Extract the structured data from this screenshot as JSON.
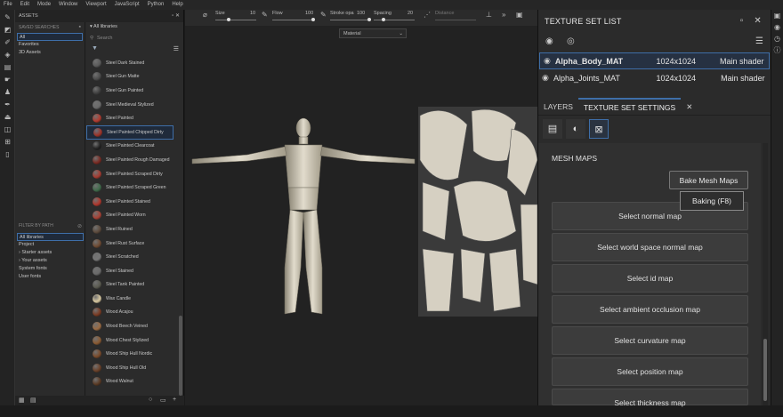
{
  "menu": [
    "File",
    "Edit",
    "Mode",
    "Window",
    "Viewport",
    "JavaScript",
    "Python",
    "Help"
  ],
  "assets": {
    "title": "ASSETS",
    "saved_searches_label": "SAVED SEARCHES",
    "saved": [
      "All",
      "Favorites",
      "3D Assets"
    ],
    "filter_by_path_label": "FILTER BY PATH",
    "paths": [
      "All libraries",
      "Project",
      "Starter assets",
      "Your assets",
      "System fonts",
      "User fonts"
    ],
    "library_header": "All libraries",
    "search_placeholder": "Search",
    "materials": [
      {
        "name": "Steel Dark Stained",
        "color": "#5a5a5a"
      },
      {
        "name": "Steel Gun Matte",
        "color": "#4a4a4a"
      },
      {
        "name": "Steel Gun Painted",
        "color": "#3d3d3d"
      },
      {
        "name": "Steel Medieval Stylized",
        "color": "#6a6a6a"
      },
      {
        "name": "Steel Painted",
        "color": "#b23a2e"
      },
      {
        "name": "Steel Painted Chipped Dirty",
        "color": "#9c3328"
      },
      {
        "name": "Steel Painted Clearcoat",
        "color": "#222222"
      },
      {
        "name": "Steel Painted Rough Damaged",
        "color": "#7a2a22"
      },
      {
        "name": "Steel Painted Scraped Dirty",
        "color": "#a63a30"
      },
      {
        "name": "Steel Painted Scraped Green",
        "color": "#3f6a4a"
      },
      {
        "name": "Steel Painted Stained",
        "color": "#b0362c"
      },
      {
        "name": "Steel Painted Worn",
        "color": "#a84034"
      },
      {
        "name": "Steel Ruined",
        "color": "#5c4a3c"
      },
      {
        "name": "Steel Rust Surface",
        "color": "#6e4a32"
      },
      {
        "name": "Steel Scratched",
        "color": "#777777"
      },
      {
        "name": "Steel Stained",
        "color": "#6a6a6a"
      },
      {
        "name": "Steel Tank Painted",
        "color": "#5a5a50"
      },
      {
        "name": "Wax Candle",
        "color": "#d8c8a0"
      },
      {
        "name": "Wood Acajou",
        "color": "#7a3a22"
      },
      {
        "name": "Wood Beech Veined",
        "color": "#9a6a42"
      },
      {
        "name": "Wood Chest Stylized",
        "color": "#8a5a32"
      },
      {
        "name": "Wood Ship Hull Nordic",
        "color": "#7a4a2a"
      },
      {
        "name": "Wood Ship Hull Old",
        "color": "#6a4028"
      },
      {
        "name": "Wood Walnut",
        "color": "#5a3a24"
      }
    ],
    "selected_material_index": 5
  },
  "toolbar": {
    "size_label": "Size",
    "size_value": "10",
    "flow_label": "Flow",
    "flow_value": "100",
    "stroke_label": "Stroke opa",
    "stroke_value": "100",
    "spacing_label": "Spacing",
    "spacing_value": "20",
    "distance_label": "Distance",
    "material_dropdown": "Material"
  },
  "texture_set_list": {
    "title": "TEXTURE SET LIST",
    "rows": [
      {
        "name": "Alpha_Body_MAT",
        "size": "1024x1024",
        "shader": "Main shader",
        "selected": true
      },
      {
        "name": "Alpha_Joints_MAT",
        "size": "1024x1024",
        "shader": "Main shader",
        "selected": false
      }
    ]
  },
  "tabs": {
    "layers": "LAYERS",
    "texture_set_settings": "TEXTURE SET SETTINGS",
    "close": "✕"
  },
  "mesh_maps": {
    "title": "MESH MAPS",
    "bake_button": "Bake Mesh Maps",
    "tooltip": "Baking (F8)",
    "buttons": [
      "Select normal map",
      "Select world space normal map",
      "Select id map",
      "Select ambient occlusion map",
      "Select curvature map",
      "Select position map",
      "Select thickness map"
    ]
  }
}
